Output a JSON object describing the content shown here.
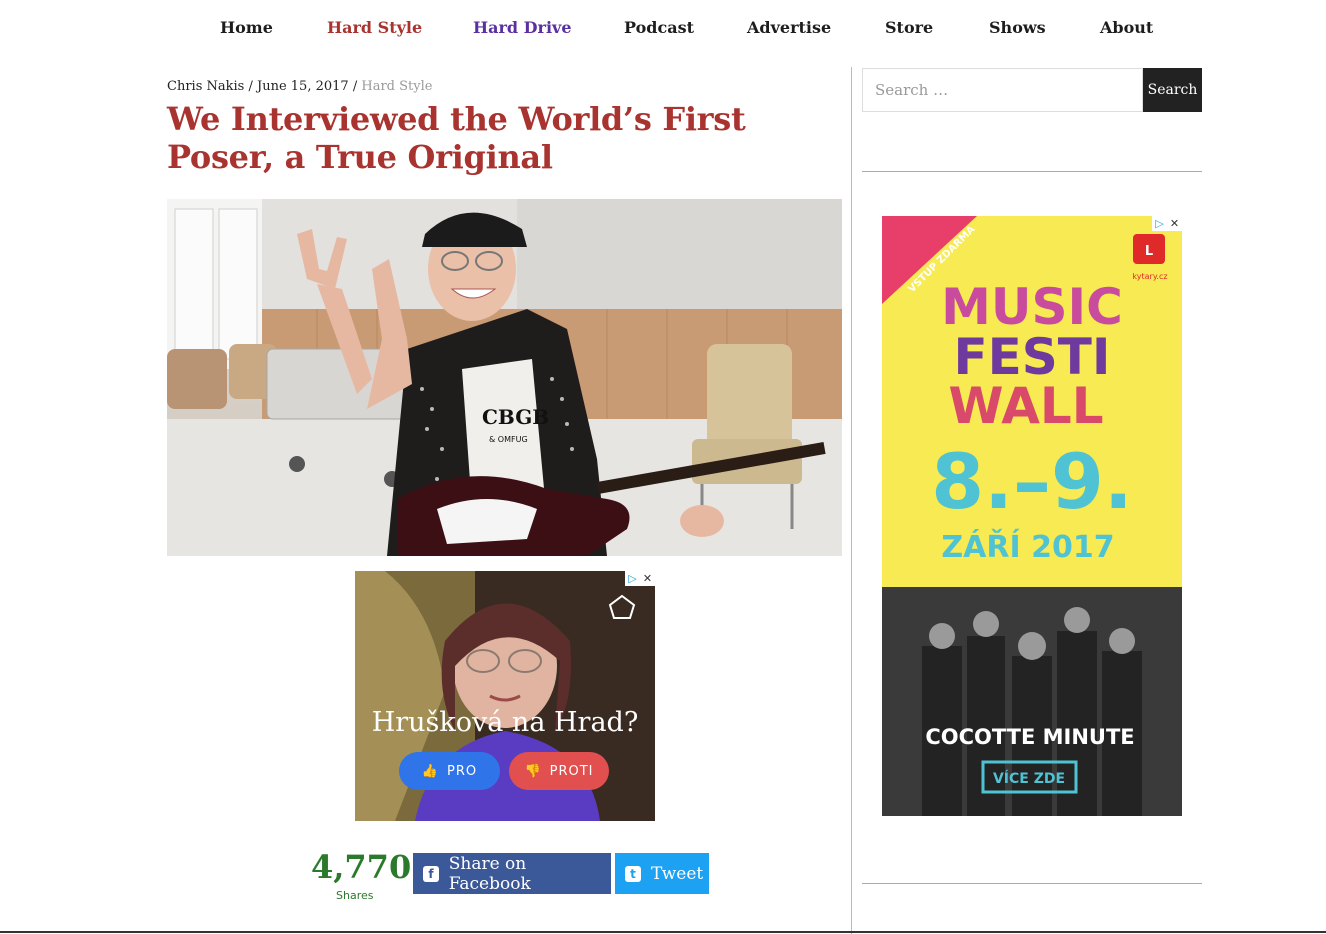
{
  "nav": {
    "items": [
      {
        "label": "Home"
      },
      {
        "label": "Hard Style"
      },
      {
        "label": "Hard Drive"
      },
      {
        "label": "Podcast"
      },
      {
        "label": "Advertise"
      },
      {
        "label": "Store"
      },
      {
        "label": "Shows"
      },
      {
        "label": "About"
      }
    ]
  },
  "article": {
    "author": "Chris Nakis",
    "separator": "/",
    "date": "June 15, 2017",
    "category": "Hard Style",
    "title": "We Interviewed the World’s First Poser, a True Original",
    "hero_shirt_text": "CBGB",
    "hero_shirt_sub": "& OMFUG"
  },
  "ad_inline": {
    "headline": "Hrušková na Hrad?",
    "pro_label": "PRO",
    "proti_label": "PROTI"
  },
  "share": {
    "count": "4,770",
    "count_label": "Shares",
    "facebook_label": "Share on Facebook",
    "twitter_label": "Tweet"
  },
  "sidebar": {
    "search_placeholder": "Search …",
    "search_button": "Search"
  },
  "ad_sidebar": {
    "ribbon": "VSTUP ZDARMA",
    "brand": "kytary.cz",
    "title_line1": "MUSIC",
    "title_line2": "FESTI",
    "title_line3": "WALL",
    "dates": "8.–9.",
    "month": "ZÁŘÍ 2017",
    "band": "COCOTTE MINUTE",
    "cta": "VÍCE ZDE"
  },
  "colors": {
    "accent_red": "#a8332f",
    "accent_purple": "#5a2fa0",
    "share_green": "#2b7a2b",
    "facebook": "#3b5998",
    "twitter": "#1da1f2",
    "ad_yellow": "#f7ea53",
    "ad_teal": "#4fc3d3"
  }
}
